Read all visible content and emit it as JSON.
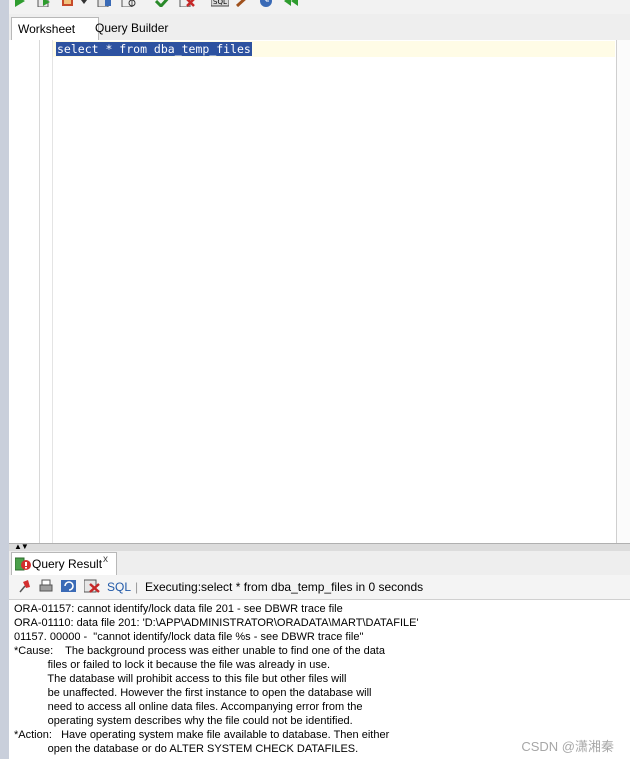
{
  "tabs": [
    {
      "label": "Worksheet",
      "active": true
    },
    {
      "label": "Query Builder",
      "active": false
    }
  ],
  "editor": {
    "sql": "select * from dba_temp_files"
  },
  "results_panel": {
    "tab_label": "Query Result",
    "tab_close": "x",
    "sql_label": "SQL",
    "separator": "|",
    "status": "Executing:select * from dba_temp_files in 0 seconds"
  },
  "output_lines": [
    "ORA-01157: cannot identify/lock data file 201 - see DBWR trace file",
    "ORA-01110: data file 201: 'D:\\APP\\ADMINISTRATOR\\ORADATA\\MART\\DATAFILE'",
    "01157. 00000 -  \"cannot identify/lock data file %s - see DBWR trace file\"",
    "*Cause:    The background process was either unable to find one of the data",
    "           files or failed to lock it because the file was already in use.",
    "           The database will prohibit access to this file but other files will",
    "           be unaffected. However the first instance to open the database will",
    "           need to access all online data files. Accompanying error from the",
    "           operating system describes why the file could not be identified.",
    "*Action:   Have operating system make file available to database. Then either",
    "           open the database or do ALTER SYSTEM CHECK DATAFILES."
  ],
  "watermark": "CSDN @潇湘秦",
  "icons": {
    "toolbar": [
      "run-statement-icon",
      "run-script-icon",
      "autotrace-icon",
      "explain-plan-icon",
      "sql-tuning-icon",
      "commit-icon",
      "rollback-icon",
      "unshared-sql-icon",
      "clear-icon",
      "history-icon",
      "dbms-output-icon"
    ],
    "results": [
      "pin-icon",
      "print-icon",
      "refresh-icon",
      "delete-icon"
    ]
  },
  "colors": {
    "selection": "#2d52a0",
    "current_line": "#fffce6",
    "sql_link": "#2159a8"
  }
}
